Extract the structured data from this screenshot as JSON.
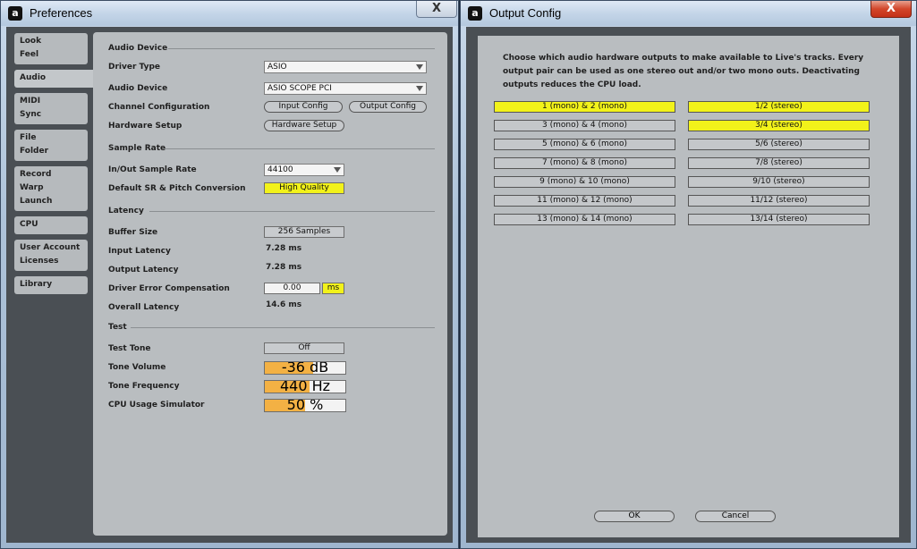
{
  "preferences": {
    "title": "Preferences",
    "close_glyph": "X",
    "app_icon_glyph": "a",
    "tabs": [
      {
        "lines": [
          "Look",
          "Feel"
        ]
      },
      {
        "lines": [
          "Audio"
        ]
      },
      {
        "lines": [
          "MIDI",
          "Sync"
        ]
      },
      {
        "lines": [
          "File",
          "Folder"
        ]
      },
      {
        "lines": [
          "Record",
          "Warp",
          "Launch"
        ]
      },
      {
        "lines": [
          "CPU"
        ]
      },
      {
        "lines": [
          "User Account",
          "Licenses"
        ]
      },
      {
        "lines": [
          "Library"
        ]
      }
    ],
    "active_tab": "Audio",
    "audio_device": {
      "heading": "Audio Device",
      "driver_type_label": "Driver Type",
      "driver_type_value": "ASIO",
      "audio_device_label": "Audio Device",
      "audio_device_value": "ASIO SCOPE PCI",
      "channel_config_label": "Channel Configuration",
      "input_config_btn": "Input Config",
      "output_config_btn": "Output Config",
      "hardware_setup_label": "Hardware Setup",
      "hardware_setup_btn": "Hardware Setup"
    },
    "sample_rate": {
      "heading": "Sample Rate",
      "in_out_label": "In/Out Sample Rate",
      "in_out_value": "44100",
      "default_sr_label": "Default SR & Pitch Conversion",
      "default_sr_value": "High Quality"
    },
    "latency": {
      "heading": "Latency",
      "buffer_size_label": "Buffer Size",
      "buffer_size_value": "256 Samples",
      "input_latency_label": "Input Latency",
      "input_latency_value": "7.28 ms",
      "output_latency_label": "Output Latency",
      "output_latency_value": "7.28 ms",
      "driver_error_label": "Driver Error Compensation",
      "driver_error_value": "0.00",
      "driver_error_unit": "ms",
      "overall_latency_label": "Overall Latency",
      "overall_latency_value": "14.6 ms"
    },
    "test": {
      "heading": "Test",
      "test_tone_label": "Test Tone",
      "test_tone_value": "Off",
      "tone_volume_label": "Tone Volume",
      "tone_volume_value": "-36 dB",
      "tone_volume_fill": 0.6,
      "tone_frequency_label": "Tone Frequency",
      "tone_frequency_value": "440 Hz",
      "tone_frequency_fill": 0.56,
      "cpu_sim_label": "CPU Usage Simulator",
      "cpu_sim_value": "50 %",
      "cpu_sim_fill": 0.5
    }
  },
  "output_config": {
    "title": "Output Config",
    "close_glyph": "X",
    "app_icon_glyph": "a",
    "description": "Choose which audio hardware outputs to make available to Live's tracks. Every output pair can be used as one stereo out and/or two mono outs.  Deactivating outputs reduces the CPU load.",
    "mono": [
      {
        "label": "1 (mono) & 2 (mono)",
        "active": true
      },
      {
        "label": "3 (mono) & 4 (mono)",
        "active": false
      },
      {
        "label": "5 (mono) & 6 (mono)",
        "active": false
      },
      {
        "label": "7 (mono) & 8 (mono)",
        "active": false
      },
      {
        "label": "9 (mono) & 10 (mono)",
        "active": false
      },
      {
        "label": "11 (mono) & 12 (mono)",
        "active": false
      },
      {
        "label": "13 (mono) & 14 (mono)",
        "active": false
      }
    ],
    "stereo": [
      {
        "label": "1/2 (stereo)",
        "active": true
      },
      {
        "label": "3/4 (stereo)",
        "active": true
      },
      {
        "label": "5/6 (stereo)",
        "active": false
      },
      {
        "label": "7/8 (stereo)",
        "active": false
      },
      {
        "label": "9/10 (stereo)",
        "active": false
      },
      {
        "label": "11/12 (stereo)",
        "active": false
      },
      {
        "label": "13/14 (stereo)",
        "active": false
      }
    ],
    "ok_label": "OK",
    "cancel_label": "Cancel"
  },
  "colors": {
    "active_yellow": "#f2f21a",
    "slider_orange": "#f3b144",
    "panel_gray": "#b9bdc0",
    "dark_frame": "#4a4f54"
  }
}
